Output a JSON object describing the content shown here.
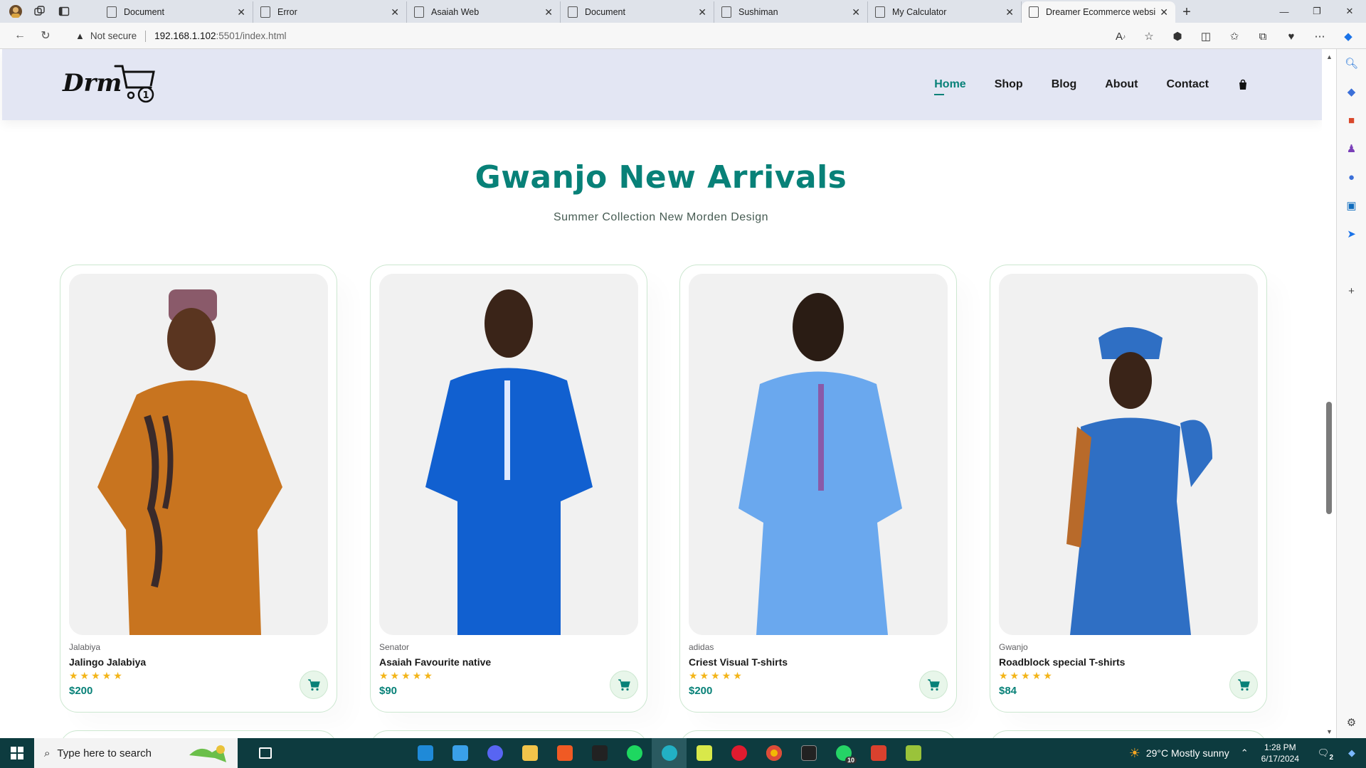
{
  "browser": {
    "tabs": [
      {
        "title": "Document"
      },
      {
        "title": "Error"
      },
      {
        "title": "Asaiah Web"
      },
      {
        "title": "Document"
      },
      {
        "title": "Sushiman"
      },
      {
        "title": "My Calculator"
      },
      {
        "title": "Dreamer Ecommerce website",
        "active": true
      }
    ],
    "security_label": "Not secure",
    "url_host": "192.168.1.102",
    "url_path": ":5501/index.html"
  },
  "site": {
    "logo_text": "Drm",
    "cart_badge": "1",
    "nav": [
      {
        "label": "Home",
        "active": true
      },
      {
        "label": "Shop"
      },
      {
        "label": "Blog"
      },
      {
        "label": "About"
      },
      {
        "label": "Contact"
      }
    ],
    "section_title": "Gwanjo New Arrivals",
    "section_subtitle": "Summer Collection New Morden Design",
    "products": [
      {
        "brand": "Jalabiya",
        "name": "Jalingo Jalabiya",
        "rating": 5,
        "stars": "★★★★★",
        "price": "$200",
        "outfit_color": "#c8741f"
      },
      {
        "brand": "Senator",
        "name": "Asaiah Favourite native",
        "rating": 5,
        "stars": "★★★★★",
        "price": "$90",
        "outfit_color": "#1160d0"
      },
      {
        "brand": "adidas",
        "name": "Criest Visual T-shirts",
        "rating": 5,
        "stars": "★★★★★",
        "price": "$200",
        "outfit_color": "#6aa8ee"
      },
      {
        "brand": "Gwanjo",
        "name": "Roadblock special T-shirts",
        "rating": 5,
        "stars": "★★★★★",
        "price": "$84",
        "outfit_color": "#2f6fc4"
      }
    ],
    "accent_color": "#088178"
  },
  "taskbar": {
    "search_placeholder": "Type here to search",
    "weather": "29°C  Mostly sunny",
    "time": "1:28 PM",
    "date": "6/17/2024",
    "notifications": "2",
    "whatsapp_badge": "10"
  }
}
